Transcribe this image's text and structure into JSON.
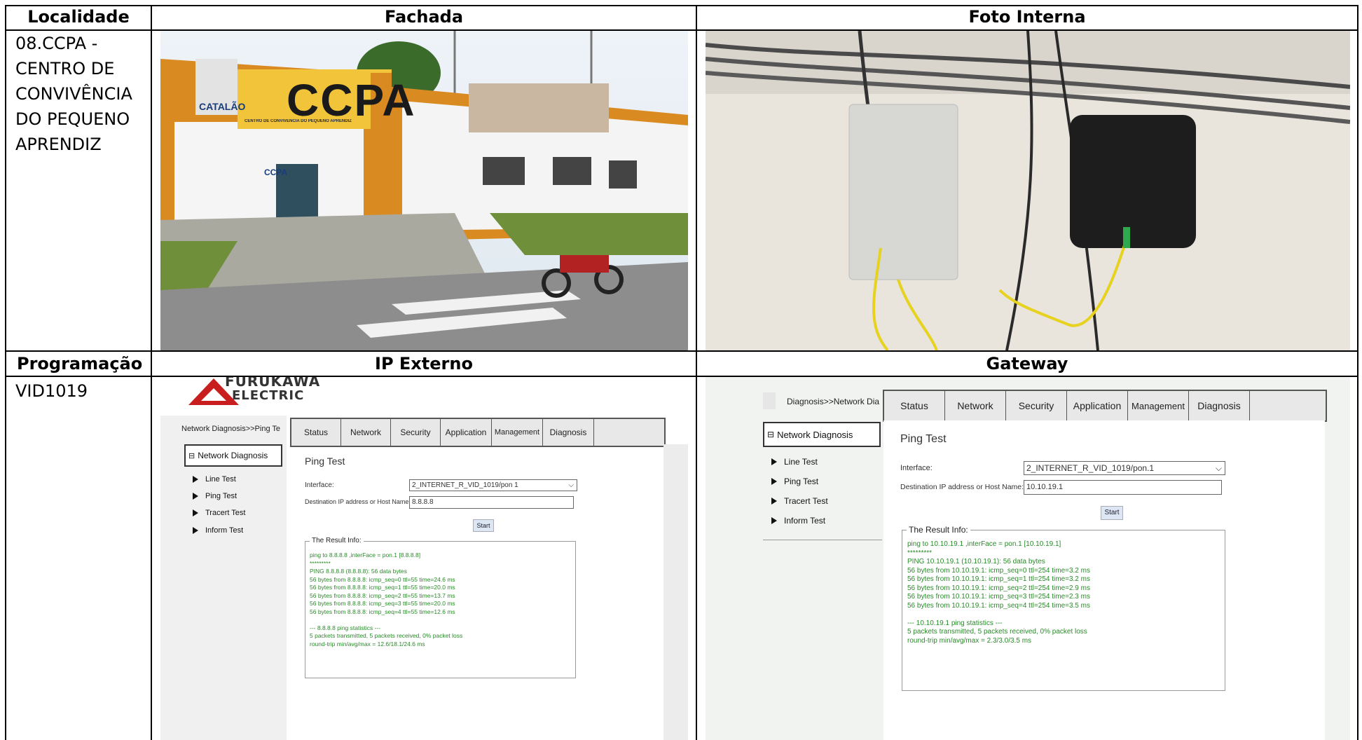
{
  "table": {
    "row1_headers": [
      "Localidade",
      "Fachada",
      "Foto Interna"
    ],
    "row2_headers": [
      "Programação",
      "IP Externo",
      "Gateway"
    ],
    "localidade": [
      "08.CCPA -",
      "CENTRO DE",
      "CONVIVÊNCIA",
      "DO PEQUENO",
      "APRENDIZ"
    ],
    "programacao": "VID1019"
  },
  "facade_photo": {
    "sign_main": "CCPA",
    "sign_sub": "CENTRO DE CONVIVÊNCIA DO PEQUENO APRENDIZ",
    "logo_text": "CATALÃO",
    "door_sign": "CCPA"
  },
  "ip_externo": {
    "brand_line1": "FURUKAWA",
    "brand_line2": "ELECTRIC",
    "breadcrumb": "Network Diagnosis>>Ping Te",
    "tabs": [
      "Status",
      "Network",
      "Security",
      "Application",
      "Management",
      "Diagnosis"
    ],
    "side_header": "Network Diagnosis",
    "side_items": [
      "Line Test",
      "Ping Test",
      "Tracert Test",
      "Inform Test"
    ],
    "page_title": "Ping Test",
    "interface_label": "Interface:",
    "interface_value": "2_INTERNET_R_VID_1019/pon 1",
    "dest_label": "Destination IP address or Host Name:",
    "dest_value": "8.8.8.8",
    "start": "Start",
    "result_title": "The Result Info:",
    "result_lines": [
      "ping to 8.8.8.8 ,interFace = pon.1 [8.8.8.8]",
      "*********",
      "PING 8.8.8.8 (8.8.8.8): 56 data bytes",
      "56 bytes from 8.8.8.8: icmp_seq=0 ttl=55 time=24.6 ms",
      "56 bytes from 8.8.8.8: icmp_seq=1 ttl=55 time=20.0 ms",
      "56 bytes from 8.8.8.8: icmp_seq=2 ttl=55 time=13.7 ms",
      "56 bytes from 8.8.8.8: icmp_seq=3 ttl=55 time=20.0 ms",
      "56 bytes from 8.8.8.8: icmp_seq=4 ttl=55 time=12.6 ms",
      "",
      "--- 8.8.8.8 ping statistics ---",
      "5 packets transmitted, 5 packets received, 0% packet loss",
      "round-trip min/avg/max = 12.6/18.1/24.6 ms"
    ]
  },
  "gateway": {
    "breadcrumb": "Diagnosis>>Network Dia",
    "tabs": [
      "Status",
      "Network",
      "Security",
      "Application",
      "Management",
      "Diagnosis"
    ],
    "side_header": "Network Diagnosis",
    "side_items": [
      "Line Test",
      "Ping Test",
      "Tracert Test",
      "Inform Test"
    ],
    "page_title": "Ping Test",
    "interface_label": "Interface:",
    "interface_value": "2_INTERNET_R_VID_1019/pon.1",
    "dest_label": "Destination IP address or Host Name:",
    "dest_value": "10.10.19.1",
    "start": "Start",
    "result_title": "The Result Info:",
    "result_lines": [
      "ping to 10.10.19.1 ,interFace = pon.1 [10.10.19.1]",
      "*********",
      "PING 10.10.19.1 (10.10.19.1): 56 data bytes",
      "56 bytes from 10.10.19.1: icmp_seq=0 ttl=254 time=3.2 ms",
      "56 bytes from 10.10.19.1: icmp_seq=1 ttl=254 time=3.2 ms",
      "56 bytes from 10.10.19.1: icmp_seq=2 ttl=254 time=2.9 ms",
      "56 bytes from 10.10.19.1: icmp_seq=3 ttl=254 time=2.3 ms",
      "56 bytes from 10.10.19.1: icmp_seq=4 ttl=254 time=3.5 ms",
      "",
      "--- 10.10.19.1 ping statistics ---",
      "5 packets transmitted, 5 packets received, 0% packet loss",
      "round-trip min/avg/max = 2.3/3.0/3.5 ms"
    ]
  }
}
